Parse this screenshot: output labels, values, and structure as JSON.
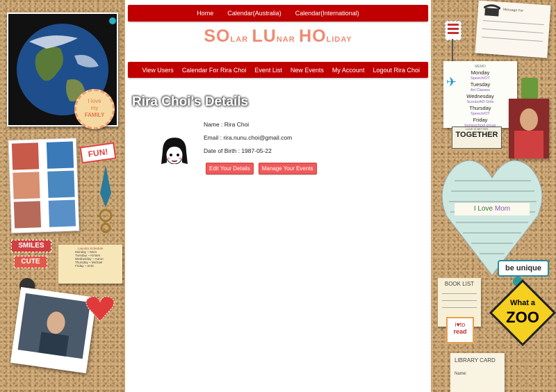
{
  "topnav": {
    "items": [
      {
        "label": "Home"
      },
      {
        "label": "Calendar(Australia)"
      },
      {
        "label": "Calendar(International)"
      }
    ]
  },
  "logo": {
    "part1_big": "SO",
    "part1_small": "LAR",
    "part2_big": "LU",
    "part2_small": "NAR",
    "part3_big": "HO",
    "part3_small": "LIDAY"
  },
  "subnav": {
    "items": [
      {
        "label": "View Users"
      },
      {
        "label": "Calendar For Rira Choi"
      },
      {
        "label": "Event List"
      },
      {
        "label": "New Events"
      },
      {
        "label": "My Account"
      },
      {
        "label": "Logout Rira Choi"
      }
    ]
  },
  "page": {
    "title": "Rira Choi's Details"
  },
  "details": {
    "name": "Name : Rira Choi",
    "email": "Email : rira.nunu.choi@gmail.com",
    "dob": "Date of Birth : 1987-05-22"
  },
  "buttons": {
    "edit": "Edit Your Details",
    "manage": "Manage Your Events"
  },
  "decor": {
    "love_family_1": "I love",
    "love_family_2": "my",
    "love_family_3": "FAMILY",
    "fun": "FUN!",
    "smiles": "SMILES",
    "cute": "CUTE",
    "laundry_title": "Laundry Schedule",
    "laundry_days": [
      "Monday ~ Mom",
      "Tuesday ~ Kirsten",
      "Wednesday ~ Aaron",
      "Thursday ~ Michael",
      "Friday ~ enric"
    ],
    "memo_title": "MEMO",
    "memo_days": [
      "Monday",
      "Speech/OT",
      "Tuesday",
      "Art Classes",
      "Wednesday",
      "Scouts/AD Girls",
      "Thursday",
      "Speech/OT",
      "Friday",
      "homeschool group"
    ],
    "together": "TOGETHER",
    "together_small": "LOVE IS BETTER",
    "i_love_mom_1": "I Love",
    "i_love_mom_2": "Mom",
    "be_unique": "be unique",
    "book_list": "BOOK LIST",
    "i_love_to": "i",
    "to_read_1": "to",
    "to_read_2": "read",
    "what_a": "What a",
    "zoo": "ZOO",
    "library_card": "LIBRARY CARD",
    "name_label": "Name:",
    "message_label": "Message For",
    "colors": {
      "nav_red": "#c00000",
      "logo_salmon": "#f08a70",
      "button_red": "#f05a5a"
    }
  }
}
